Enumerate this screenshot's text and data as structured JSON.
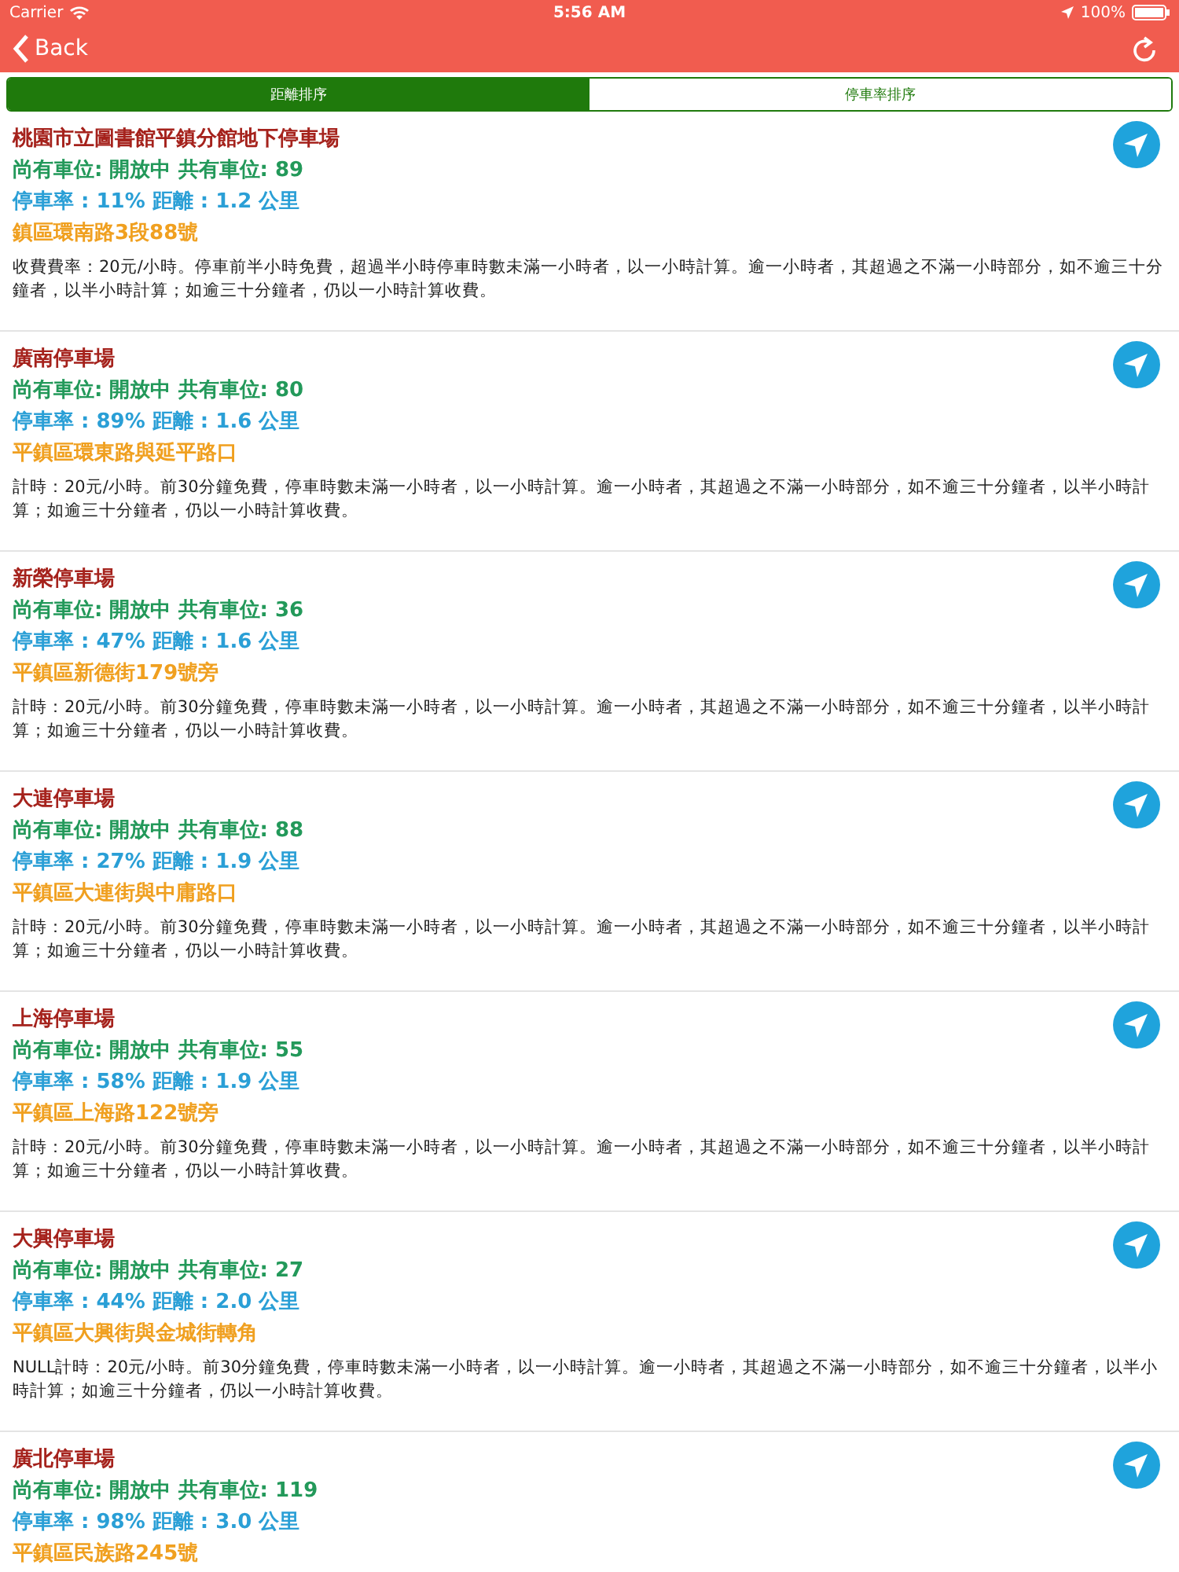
{
  "status_bar": {
    "carrier": "Carrier",
    "time": "5:56 AM",
    "battery": "100%"
  },
  "nav": {
    "back": "Back"
  },
  "segments": [
    {
      "label": "距離排序",
      "selected": true
    },
    {
      "label": "停車率排序",
      "selected": false
    }
  ],
  "lots": [
    {
      "name": "桃園市立圖書館平鎮分館地下停車場",
      "availability": "尚有車位: 開放中  共有車位: 89",
      "rate": "停車率 : 11%  距離 : 1.2 公里",
      "address": "鎮區環南路3段88號",
      "fee": "收費費率：20元/小時。停車前半小時免費，超過半小時停車時數未滿一小時者，以一小時計算。逾一小時者，其超過之不滿一小時部分，如不逾三十分鐘者，以半小時計算；如逾三十分鐘者，仍以一小時計算收費。"
    },
    {
      "name": "廣南停車場",
      "availability": "尚有車位: 開放中  共有車位: 80",
      "rate": "停車率 : 89%  距離 : 1.6 公里",
      "address": "平鎮區環東路與延平路口",
      "fee": "計時：20元/小時。前30分鐘免費，停車時數未滿一小時者，以一小時計算。逾一小時者，其超過之不滿一小時部分，如不逾三十分鐘者，以半小時計算；如逾三十分鐘者，仍以一小時計算收費。"
    },
    {
      "name": "新榮停車場",
      "availability": "尚有車位: 開放中  共有車位: 36",
      "rate": "停車率 : 47%  距離 : 1.6 公里",
      "address": "平鎮區新德街179號旁",
      "fee": "計時：20元/小時。前30分鐘免費，停車時數未滿一小時者，以一小時計算。逾一小時者，其超過之不滿一小時部分，如不逾三十分鐘者，以半小時計算；如逾三十分鐘者，仍以一小時計算收費。"
    },
    {
      "name": "大連停車場",
      "availability": "尚有車位: 開放中  共有車位: 88",
      "rate": "停車率 : 27%  距離 : 1.9 公里",
      "address": "平鎮區大連街與中庸路口",
      "fee": "計時：20元/小時。前30分鐘免費，停車時數未滿一小時者，以一小時計算。逾一小時者，其超過之不滿一小時部分，如不逾三十分鐘者，以半小時計算；如逾三十分鐘者，仍以一小時計算收費。"
    },
    {
      "name": "上海停車場",
      "availability": "尚有車位: 開放中  共有車位: 55",
      "rate": "停車率 : 58%  距離 : 1.9 公里",
      "address": "平鎮區上海路122號旁",
      "fee": "計時：20元/小時。前30分鐘免費，停車時數未滿一小時者，以一小時計算。逾一小時者，其超過之不滿一小時部分，如不逾三十分鐘者，以半小時計算；如逾三十分鐘者，仍以一小時計算收費。"
    },
    {
      "name": "大興停車場",
      "availability": "尚有車位: 開放中  共有車位: 27",
      "rate": "停車率 : 44%  距離 : 2.0 公里",
      "address": "平鎮區大興街與金城街轉角",
      "fee": "NULL計時：20元/小時。前30分鐘免費，停車時數未滿一小時者，以一小時計算。逾一小時者，其超過之不滿一小時部分，如不逾三十分鐘者，以半小時計算；如逾三十分鐘者，仍以一小時計算收費。"
    },
    {
      "name": "廣北停車場",
      "availability": "尚有車位: 開放中  共有車位: 119",
      "rate": "停車率 : 98%  距離 : 3.0 公里",
      "address": "平鎮區民族路245號"
    }
  ]
}
